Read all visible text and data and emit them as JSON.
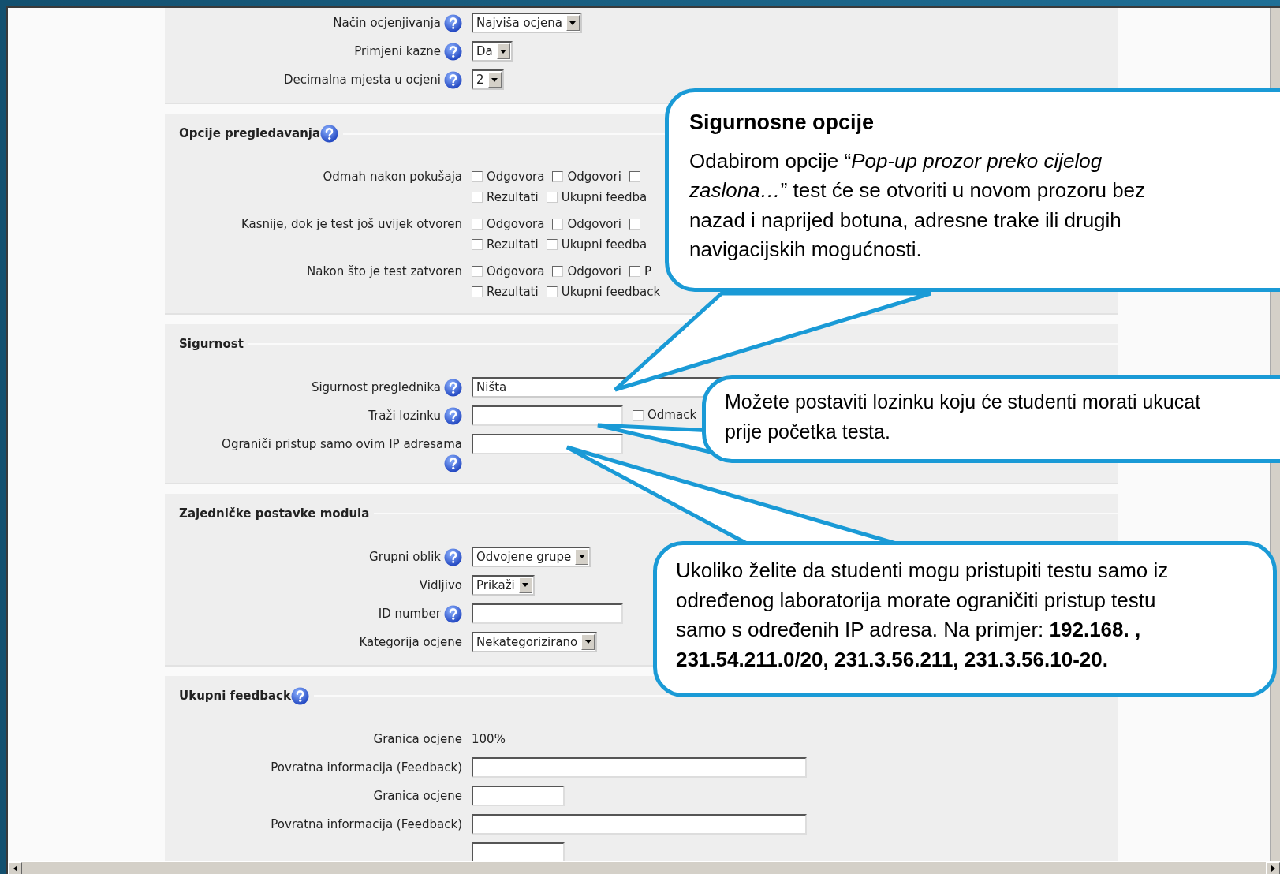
{
  "sections": [
    {
      "rows": [
        {
          "label": "Način ocjenjivanja",
          "help": true,
          "control": {
            "kind": "select",
            "value": "Najviša ocjena"
          }
        },
        {
          "label": "Primjeni kazne",
          "help": true,
          "control": {
            "kind": "select",
            "value": "Da"
          }
        },
        {
          "label": "Decimalna mjesta u ocjeni",
          "help": true,
          "control": {
            "kind": "select",
            "value": "2"
          }
        }
      ]
    },
    {
      "legend": "Opcije pregledavanja",
      "legend_help": true,
      "rows": [
        {
          "label": "Odmah nakon pokušaja",
          "help": false,
          "control": {
            "kind": "checkboxes",
            "lines": [
              [
                {
                  "label": "Odgovora",
                  "checked": false
                },
                {
                  "label": "Odgovori",
                  "checked": false
                },
                {
                  "checked": false
                }
              ],
              [
                {
                  "label": "Rezultati",
                  "checked": false
                },
                {
                  "label": "Ukupni feedba",
                  "checked": false
                }
              ]
            ]
          }
        },
        {
          "label": "Kasnije, dok je test još uvijek otvoren",
          "help": false,
          "control": {
            "kind": "checkboxes",
            "lines": [
              [
                {
                  "label": "Odgovora",
                  "checked": false
                },
                {
                  "label": "Odgovori",
                  "checked": false
                },
                {
                  "checked": false
                }
              ],
              [
                {
                  "label": "Rezultati",
                  "checked": false
                },
                {
                  "label": "Ukupni feedba",
                  "checked": false
                }
              ]
            ]
          }
        },
        {
          "label": "Nakon što je test zatvoren",
          "help": false,
          "control": {
            "kind": "checkboxes",
            "lines": [
              [
                {
                  "label": "Odgovora",
                  "checked": false
                },
                {
                  "label": "Odgovori",
                  "checked": false
                },
                {
                  "label": "P",
                  "checked": false
                }
              ],
              [
                {
                  "label": "Rezultati",
                  "checked": false
                },
                {
                  "label": "Ukupni feedback",
                  "checked": false
                }
              ]
            ]
          }
        }
      ]
    },
    {
      "legend": "Sigurnost",
      "legend_help": false,
      "rows": [
        {
          "label": "Sigurnost preglednika",
          "help": true,
          "control": {
            "kind": "select",
            "value": "Ništa"
          }
        },
        {
          "label": "Traži lozinku",
          "help": true,
          "control": {
            "kind": "text",
            "checkbox": {
              "label": "Odmack",
              "checked": false
            }
          }
        },
        {
          "label": "Ograniči pristup samo ovim IP adresama",
          "help": true,
          "control": {
            "kind": "text"
          }
        }
      ]
    },
    {
      "legend": "Zajedničke postavke modula",
      "legend_help": false,
      "rows": [
        {
          "label": "Grupni oblik",
          "help": true,
          "control": {
            "kind": "select",
            "value": "Odvojene grupe"
          }
        },
        {
          "label": "Vidljivo",
          "help": false,
          "control": {
            "kind": "select",
            "value": "Prikaži"
          }
        },
        {
          "label": "ID number",
          "help": true,
          "control": {
            "kind": "text"
          }
        },
        {
          "label": "Kategorija ocjene",
          "help": false,
          "control": {
            "kind": "select",
            "value": "Nekategorizirano"
          }
        }
      ]
    },
    {
      "legend": "Ukupni feedback",
      "legend_help": true,
      "rows": [
        {
          "label": "Granica ocjene",
          "help": false,
          "control": {
            "kind": "static",
            "value": "100%"
          }
        },
        {
          "label": "Povratna informacija (Feedback)",
          "help": false,
          "control": {
            "kind": "text"
          }
        },
        {
          "label": "Granica ocjene",
          "help": false,
          "control": {
            "kind": "text"
          }
        },
        {
          "label": "Povratna informacija (Feedback)",
          "help": false,
          "control": {
            "kind": "text"
          }
        },
        {
          "help": false,
          "control": {
            "kind": "text"
          }
        }
      ]
    }
  ],
  "callouts": [
    {
      "title": "Sigurnosne opcije",
      "lines": [
        "Odabirom opcije “*Pop-up prozor preko cijelog*",
        "*zaslona…*”  test će se otvoriti u novom prozoru bez",
        "nazad i naprijed botuna, adresne trake ili drugih",
        "navigacijskih mogućnosti."
      ]
    },
    {
      "lines": [
        "Možete postaviti lozinku koju će studenti morati ukucat",
        "prije početka testa."
      ]
    },
    {
      "lines": [
        "Ukoliko želite da studenti mogu pristupiti testu samo iz",
        "određenog laboratorija morate ograničiti pristup testu",
        "samo s određenih IP adresa. Na primjer: **192.168. ,**",
        "**231.54.211.0/20, 231.3.56.211, 231.3.56.10-20.**"
      ]
    }
  ]
}
